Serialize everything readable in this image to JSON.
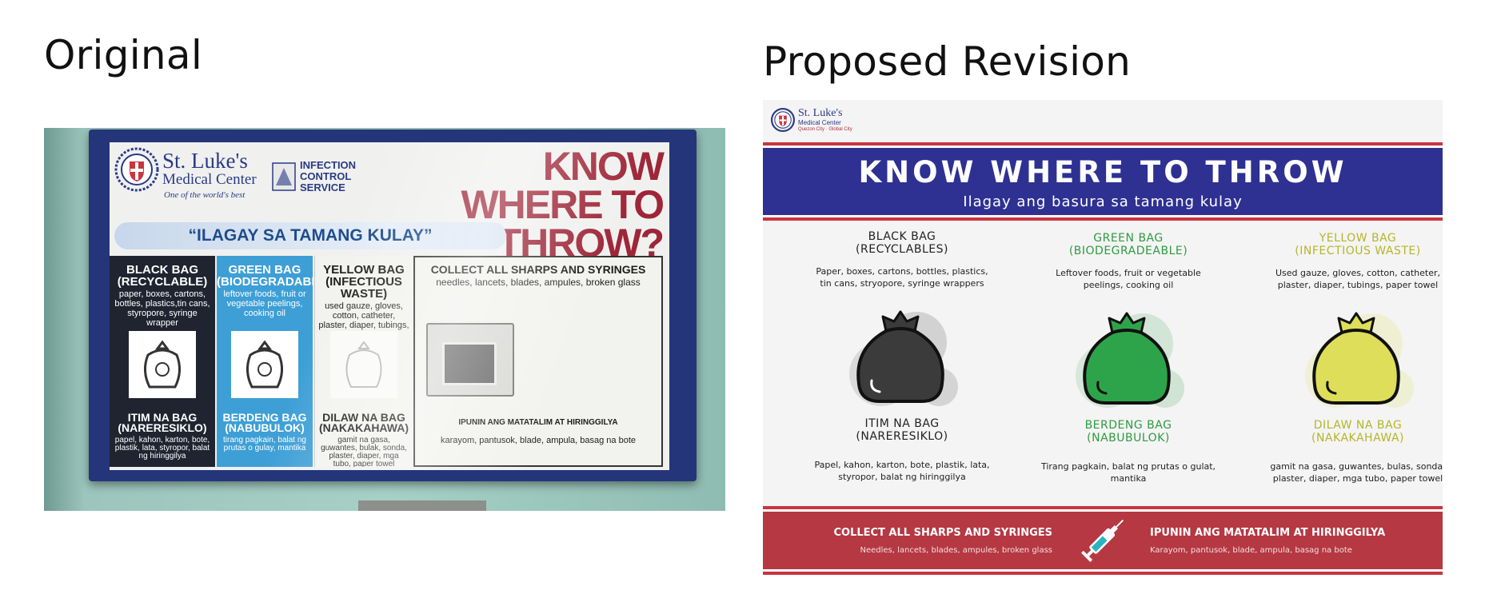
{
  "headings": {
    "original": "Original",
    "revision": "Proposed Revision"
  },
  "original_poster": {
    "logo": {
      "name": "St. Luke's",
      "sub": "Medical Center",
      "tagline": "One of the world's best"
    },
    "service": "INFECTION CONTROL SERVICE",
    "title_lines": [
      "KNOW",
      "WHERE TO",
      "THROW?"
    ],
    "banner": "“ILAGAY SA TAMANG KULAY”",
    "panels": [
      {
        "title": "BLACK BAG (RECYCLABLE)",
        "desc": "paper, boxes, cartons, bottles, plastics,tin cans, styropore, syringe wrapper",
        "title_local": "ITIM NA BAG (NARERESIKLO)",
        "desc_local": "papel, kahon, karton, bote, plastik, lata, styropor, balat ng hiringgilya"
      },
      {
        "title": "GREEN BAG (BIODEGRADABLE)",
        "desc": "leftover foods, fruit or vegetable peelings, cooking oil",
        "title_local": "BERDENG BAG (NABUBULOK)",
        "desc_local": "tirang pagkain, balat ng prutas o gulay, mantika"
      },
      {
        "title": "YELLOW BAG (INFECTIOUS WASTE)",
        "desc": "used gauze, gloves, cotton, catheter, plaster, diaper, tubings, paper towel",
        "title_local": "DILAW NA BAG (NAKAKAHAWA)",
        "desc_local": "gamit na gasa, guwantes, bulak, sonda, plaster, diaper, mga tubo, paper towel"
      },
      {
        "title": "COLLECT ALL SHARPS AND SYRINGES",
        "desc": "needles, lancets, blades, ampules, broken glass",
        "title_local": "IPUNIN ANG MATATALIM AT HIRINGGILYA",
        "desc_local": "karayom, pantusok, blade, ampula, basag na bote"
      }
    ]
  },
  "revision_poster": {
    "logo": {
      "name": "St. Luke's",
      "sub": "Medical Center",
      "tagline": "Quezon City · Global City"
    },
    "title": "KNOW WHERE TO THROW",
    "subtitle": "Ilagay ang basura sa tamang kulay",
    "columns": [
      {
        "title_en": "BLACK BAG",
        "sub_en": "(RECYCLABLES)",
        "desc_en": "Paper, boxes, cartons, bottles, plastics, tin cans, stryopore, syringe wrappers",
        "title_local": "ITIM NA BAG",
        "sub_local": "(NARERESIKLO)",
        "desc_local": "Papel, kahon, karton, bote, plastik, lata, styropor, balat ng hiringgilya"
      },
      {
        "title_en": "GREEN BAG",
        "sub_en": "(BIODEGRADEABLE)",
        "desc_en": "Leftover foods, fruit or vegetable peelings, cooking oil",
        "title_local": "BERDENG BAG",
        "sub_local": "(NABUBULOK)",
        "desc_local": "Tirang pagkain, balat ng prutas o gulat, mantika"
      },
      {
        "title_en": "YELLOW BAG",
        "sub_en": "(INFECTIOUS WASTE)",
        "desc_en": "Used gauze, gloves, cotton, catheter, plaster, diaper, tubings, paper towel",
        "title_local": "DILAW NA BAG",
        "sub_local": "(NAKAKAHAWA)",
        "desc_local": "gamit na gasa, guwantes, bulas, sonda, plaster, diaper, mga tubo, paper towel"
      }
    ],
    "sharps": {
      "title_en": "COLLECT ALL SHARPS AND SYRINGES",
      "desc_en": "Needles, lancets, blades, ampules, broken glass",
      "title_local": "IPUNIN ANG MATATALIM AT HIRINGGILYA",
      "desc_local": "Karayom, pantusok, blade, ampula, basag na bote"
    }
  },
  "colors": {
    "navy": "#2e3192",
    "red": "#b53842",
    "black_bag": "#3b3b3b",
    "green_bag": "#2ea44a",
    "yellow_bag": "#dede5a"
  },
  "icons": [
    "hospital-seal-icon",
    "trash-bag-icon",
    "syringe-icon",
    "sharps-container-icon"
  ]
}
